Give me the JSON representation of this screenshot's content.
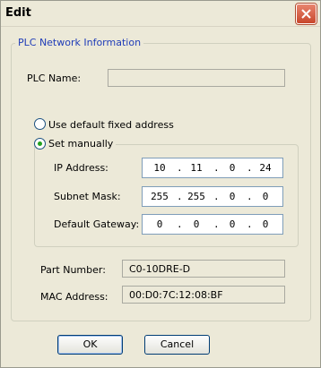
{
  "window": {
    "title": "Edit"
  },
  "group": {
    "legend": "PLC Network Information",
    "plc_name_label": "PLC Name:",
    "plc_name_value": "",
    "address_options": {
      "default_label": "Use default fixed address",
      "manual_label": "Set manually",
      "selected": "manual"
    },
    "ip_address": {
      "label": "IP Address:",
      "octets": [
        "10",
        "11",
        "0",
        "24"
      ]
    },
    "subnet_mask": {
      "label": "Subnet Mask:",
      "octets": [
        "255",
        "255",
        "0",
        "0"
      ]
    },
    "default_gateway": {
      "label": "Default Gateway:",
      "octets": [
        "0",
        "0",
        "0",
        "0"
      ]
    },
    "part_number": {
      "label": "Part Number:",
      "value": "C0-10DRE-D"
    },
    "mac_address": {
      "label": "MAC Address:",
      "value": "00:D0:7C:12:08:BF"
    }
  },
  "buttons": {
    "ok": "OK",
    "cancel": "Cancel"
  },
  "icons": {
    "close": "close-icon"
  },
  "colors": {
    "legend_text": "#1f3cb8",
    "radio_dot": "#21a121",
    "close_button": "#c8472c"
  }
}
